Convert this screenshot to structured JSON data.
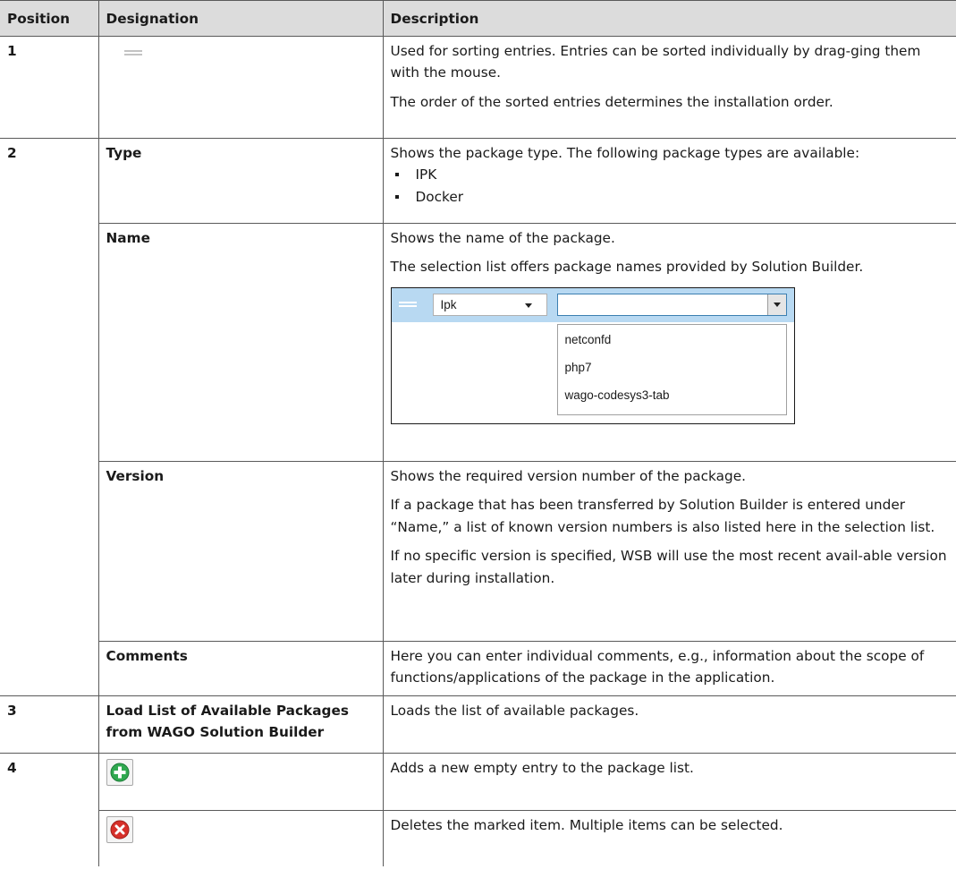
{
  "table": {
    "headers": {
      "position": "Position",
      "designation": "Designation",
      "description": "Description"
    },
    "row1": {
      "position": "1",
      "icon": "drag-handle-icon",
      "desc_p1": "Used for sorting entries. Entries can be sorted individually by drag-ging them with the mouse.",
      "desc_p2": "The order of the sorted entries determines the installation order."
    },
    "row_type": {
      "position": "2",
      "designation": "Type",
      "desc": "Shows the package type. The following package types are available:",
      "bullets": [
        "IPK",
        "Docker"
      ]
    },
    "row_name": {
      "designation": "Name",
      "desc_p1": "Shows the name of the package.",
      "desc_p2": "The selection list offers package names provided by Solution Builder.",
      "screenshot": {
        "type_value": "Ipk",
        "name_value": "",
        "options": [
          "netconfd",
          "php7",
          "wago-codesys3-tab"
        ]
      }
    },
    "row_version": {
      "designation": "Version",
      "desc_p1": "Shows the required version number of the package.",
      "desc_p2": "If a package that has been transferred by Solution Builder is entered under “Name,” a list of known version numbers is also listed here in the selection list.",
      "desc_p3": "If no specific version is specified, WSB will use the most recent avail-able version later during installation."
    },
    "row_comments": {
      "designation": "Comments",
      "desc": "Here you can enter individual comments, e.g., information about the scope of functions/applications of the package in the application."
    },
    "row3": {
      "position": "3",
      "designation_line1": "Load List of Available Packages",
      "designation_line2": "from WAGO Solution Builder",
      "desc": "Loads the list of available packages."
    },
    "row4_add": {
      "position": "4",
      "icon": "add-icon",
      "desc": "Adds a new empty entry to the package list.",
      "icon_color": "#2fa84f"
    },
    "row4_delete": {
      "icon": "delete-icon",
      "desc": "Deletes the marked item. Multiple items can be selected.",
      "icon_color": "#d6302a"
    }
  }
}
